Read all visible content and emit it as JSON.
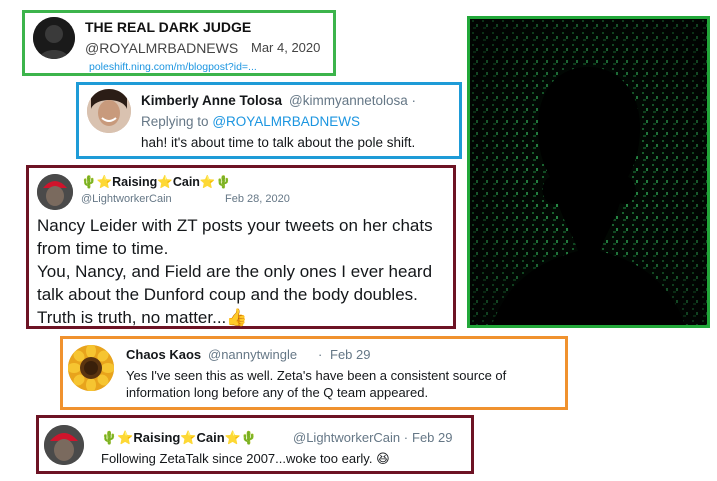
{
  "tweet_main": {
    "name": "THE REAL DARK JUDGE",
    "handle": "@ROYALMRBADNEWS",
    "date": "Mar 4, 2020",
    "link": "poleshift.ning.com/m/blogpost?id=..."
  },
  "reply1": {
    "name": "Kimberly Anne Tolosa",
    "handle": "@kimmyannetolosa",
    "separator": "·",
    "replying_prefix": "Replying to",
    "replying_to": "@ROYALMRBADNEWS",
    "text": "hah! it's about time to talk about the pole shift."
  },
  "reply2": {
    "name": "🌵⭐Raising⭐Cain⭐🌵",
    "handle": "@LightworkerCain",
    "date": "Feb 28, 2020",
    "lines": [
      "Nancy Leider with ZT posts your tweets on her chats",
      "from time to time.",
      "You, Nancy, and Field are the only ones I ever heard",
      "talk about the Dunford coup and the body doubles.",
      "Truth is truth, no matter...👍"
    ]
  },
  "reply3": {
    "name": "Chaos Kaos",
    "handle": "@nannytwingle",
    "separator": "·",
    "date": "Feb 29",
    "lines": [
      "Yes I've seen this as well. Zeta's have been a consistent source of",
      "information long before any of the Q team appeared."
    ]
  },
  "reply4": {
    "name": "🌵⭐Raising⭐Cain⭐🌵",
    "handle": "@LightworkerCain",
    "separator": "·",
    "date": "Feb 29",
    "text": "Following ZetaTalk since 2007...woke too early. 😆"
  },
  "colors": {
    "border_green": "#3cb44b",
    "border_blue": "#1e9bd7",
    "border_maroon": "#6d1324",
    "border_orange": "#f0922e",
    "link_blue": "#1b95e0"
  }
}
